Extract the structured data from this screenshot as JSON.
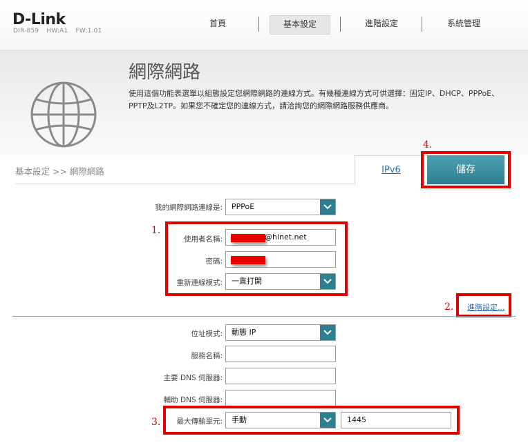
{
  "brand": {
    "logo": "D-Link",
    "model": "DIR-859",
    "hw": "HW:A1",
    "fw": "FW:1.01"
  },
  "nav": {
    "home": "首頁",
    "basic": "基本設定",
    "advanced": "進階設定",
    "system": "系統管理"
  },
  "banner": {
    "title": "網際網路",
    "description": "使用這個功能表選單以組態設定您網際網路的連線方式。有幾種連線方式可供選擇：固定IP、DHCP、PPPoE、PPTP及L2TP。如果您不確定您的連線方式，請洽詢您的網際網路服務供應商。"
  },
  "breadcrumb": "基本設定 >> 網際網路",
  "tabs": {
    "ipv6": "IPv6",
    "save": "儲存"
  },
  "annotations": {
    "one": "1.",
    "two": "2.",
    "three": "3.",
    "four": "4."
  },
  "form": {
    "connection_type_label": "我的網際網路連線是:",
    "connection_type": "PPPoE",
    "username_label": "使用者名稱:",
    "username_suffix": "@hinet.net",
    "password_label": "密碼:",
    "reconnect_label": "重新連線模式:",
    "reconnect_mode": "一直打開",
    "advanced_link": "進階設定...",
    "address_mode_label": "位址模式:",
    "address_mode": "動態 IP",
    "service_name_label": "服務名稱:",
    "service_name": "",
    "primary_dns_label": "主要 DNS 伺服器:",
    "primary_dns": "",
    "secondary_dns_label": "輔助 DNS 伺服器:",
    "secondary_dns": "",
    "mtu_label": "最大傳輸單元:",
    "mtu_mode": "手動",
    "mtu_value": "1445"
  },
  "colors": {
    "accent": "#2e7f90",
    "annotation": "#e00000",
    "link": "#2a6fb0"
  }
}
